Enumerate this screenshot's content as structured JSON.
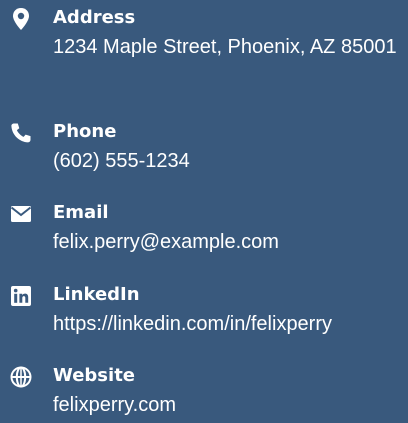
{
  "background_color": "#39597d",
  "text_color": "#ffffff",
  "contacts": [
    {
      "icon": "map-pin-icon",
      "label": "Address",
      "value": "1234 Maple Street, Phoenix, AZ 85001"
    },
    {
      "icon": "phone-icon",
      "label": "Phone",
      "value": "(602) 555-1234"
    },
    {
      "icon": "envelope-icon",
      "label": "Email",
      "value": "felix.perry@example.com"
    },
    {
      "icon": "linkedin-icon",
      "label": "LinkedIn",
      "value": "https://linkedin.com/in/felixperry"
    },
    {
      "icon": "globe-icon",
      "label": "Website",
      "value": "felixperry.com"
    }
  ]
}
